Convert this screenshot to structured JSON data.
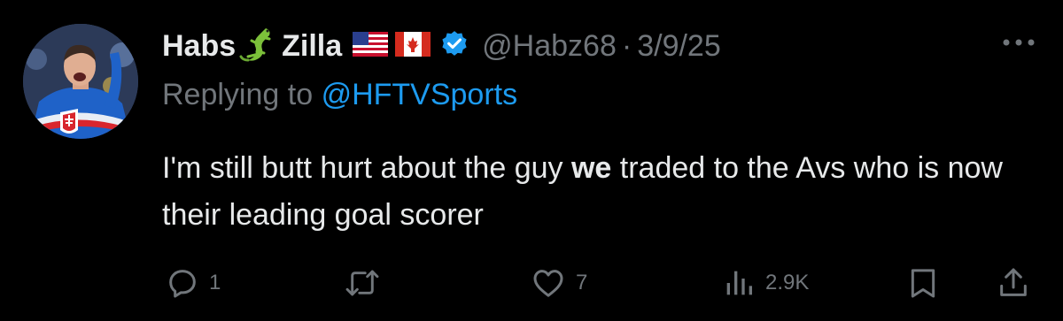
{
  "tweet": {
    "display_name_part1": "Habs",
    "display_name_part2": "Zilla",
    "handle": "@Habz68",
    "separator": "·",
    "date": "3/9/25",
    "replying_prefix": "Replying to",
    "replying_handle": "@HFTVSports",
    "text_part1": "I'm still butt hurt about the guy ",
    "text_bold": "we",
    "text_part2": " traded to the Avs who is now their leading goal scorer"
  },
  "actions": {
    "replies_count": "1",
    "likes_count": "7",
    "views_count": "2.9K"
  },
  "icons": {
    "name_emoji": "lizard-icon",
    "flags": [
      "us-flag-icon",
      "canada-flag-icon"
    ],
    "verified": "verified-badge-icon",
    "more": "more-dots-icon",
    "reply": "reply-icon",
    "retweet": "retweet-icon",
    "like": "heart-icon",
    "views": "views-icon",
    "bookmark": "bookmark-icon",
    "share": "share-icon"
  },
  "colors": {
    "background": "#000000",
    "text": "#e7e9ea",
    "muted": "#71767b",
    "link": "#1d9bf0"
  }
}
